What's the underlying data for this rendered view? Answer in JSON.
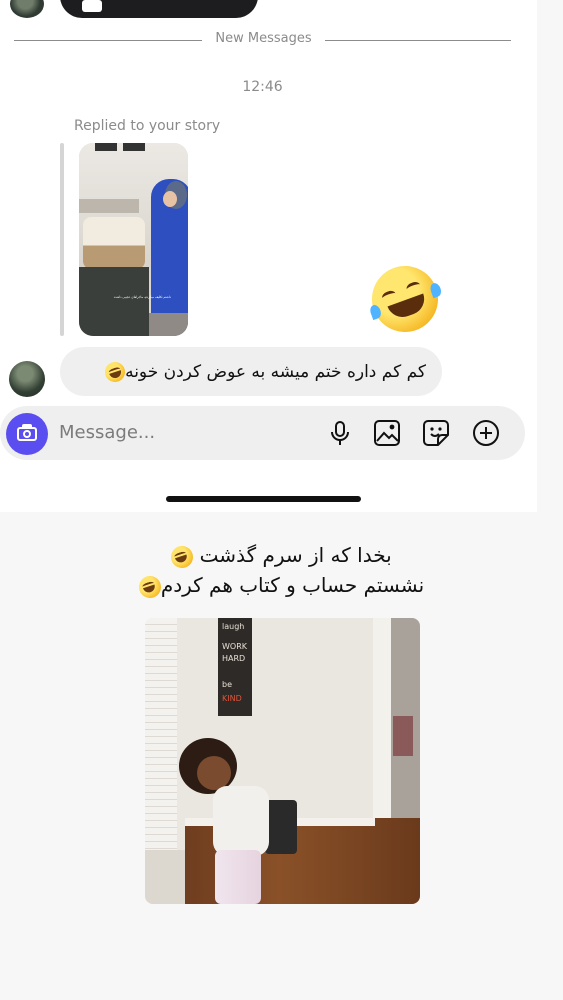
{
  "chat": {
    "divider_label": "New Messages",
    "timestamp": "12:46",
    "story_reply_label": "Replied to your story",
    "story_caption": "داشتم تکلیف میکردم، ماجراهای عجیبی داشت",
    "incoming_message": "کم کم داره ختم میشه به عوض کردن خونه",
    "reaction_emoji_name": "rolling-on-floor-laughing"
  },
  "composer": {
    "placeholder": "Message...",
    "camera_color": "#5a4ef0"
  },
  "meme": {
    "caption_line1": "بخدا که از سرم گذشت",
    "caption_line2": "نشستم حساب و کتاب هم کردم",
    "sign_words": [
      "laugh",
      "WORK",
      "HARD",
      "be",
      "KIND"
    ]
  },
  "icons": [
    "camera-icon",
    "microphone-icon",
    "image-icon",
    "sticker-icon",
    "plus-icon"
  ]
}
